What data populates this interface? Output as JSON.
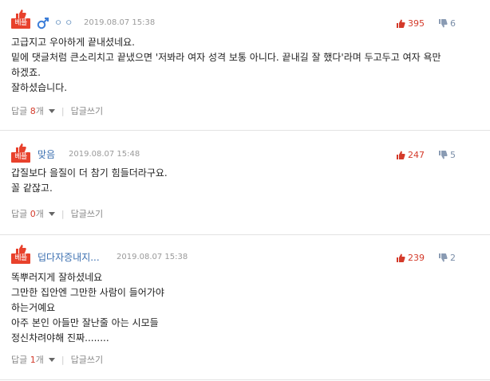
{
  "comments": [
    {
      "badge": "베플",
      "author_dots": "ㅇㅇ",
      "timestamp": "2019.08.07 15:38",
      "upvotes": "395",
      "downvotes": "6",
      "lines": [
        "고급지고 우아하게 끝내셨네요.",
        "밑에 댓글처럼 큰소리치고 끝냈으면 '저봐라 여자 성격 보통 아니다. 끝내길 잘 했다'라며 두고두고 여자 욕만",
        "하겠죠.",
        "잘하셨습니다."
      ],
      "reply_label": "답글",
      "reply_count": "8",
      "reply_unit": "개",
      "write_reply": "답글쓰기"
    },
    {
      "badge": "베플",
      "author": "맞음",
      "timestamp": "2019.08.07 15:48",
      "upvotes": "247",
      "downvotes": "5",
      "lines": [
        "갑질보다 을질이 더 참기 힘들더라구요.",
        "꼴 같잖고."
      ],
      "reply_label": "답글",
      "reply_count": "0",
      "reply_unit": "개",
      "write_reply": "답글쓰기"
    },
    {
      "badge": "베플",
      "author": "덥다자증내지...",
      "timestamp": "2019.08.07 15:38",
      "upvotes": "239",
      "downvotes": "2",
      "lines": [
        "똑뿌러지게 잘하셨네요",
        "그만한 집안엔 그만한 사람이 들어가야",
        "하는거예요",
        "아주 본인 아들만 잘난줄 아는 시모들",
        "정신차려야해 진짜........"
      ],
      "reply_label": "답글",
      "reply_count": "1",
      "reply_unit": "개",
      "write_reply": "답글쓰기"
    }
  ],
  "icons": {
    "best": "thumbs-up-icon",
    "gender": "male-icon",
    "up": "thumbs-up-icon",
    "down": "thumbs-down-icon",
    "expand": "caret-down-icon"
  },
  "colors": {
    "accent": "#e8412c",
    "upvote": "#d43a2a",
    "downvote": "#7a8ea8",
    "nickname": "#3b6fb0"
  }
}
